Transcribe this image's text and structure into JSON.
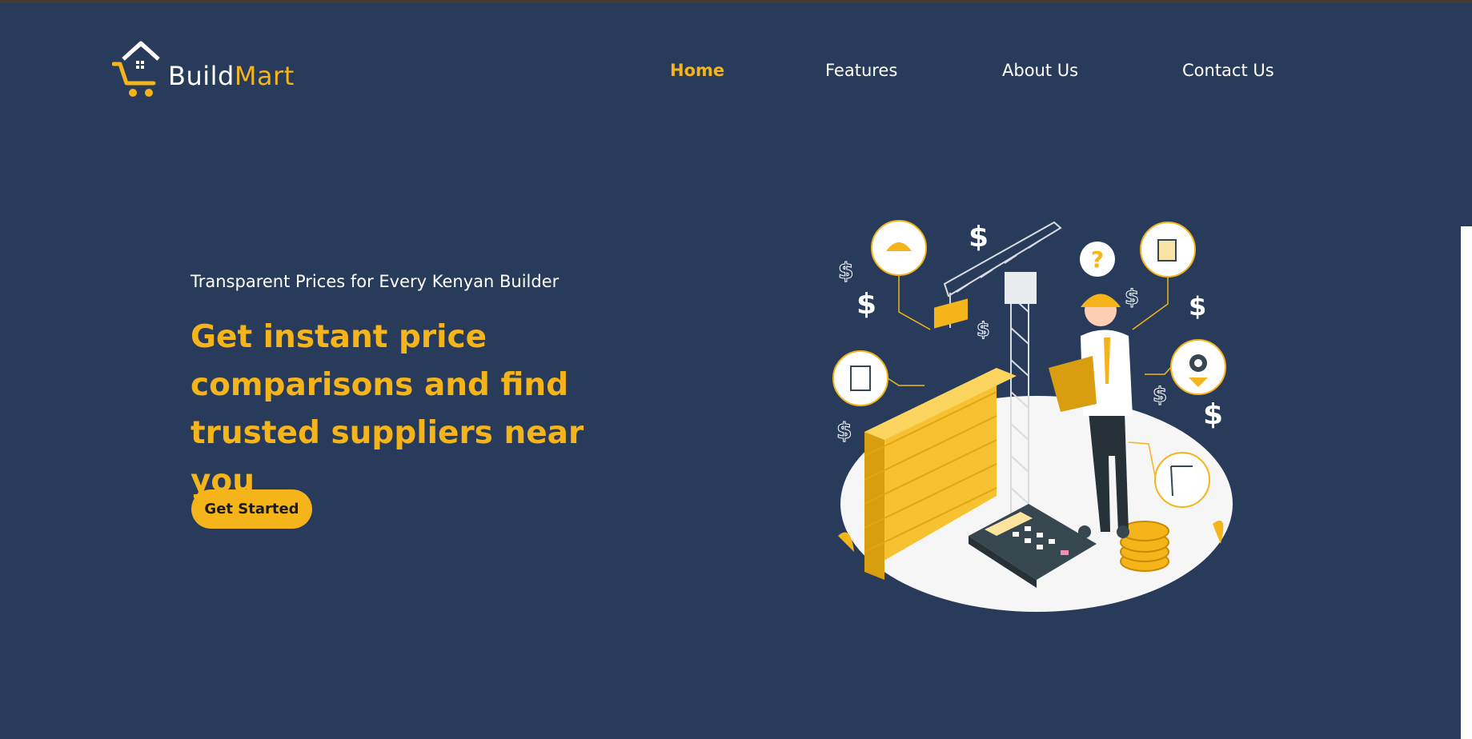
{
  "brand": {
    "name_part1": "Build",
    "name_part2": "Mart"
  },
  "nav": {
    "items": [
      {
        "label": "Home"
      },
      {
        "label": "Features"
      },
      {
        "label": "About Us"
      },
      {
        "label": "Contact Us"
      }
    ]
  },
  "hero": {
    "subtitle": "Transparent Prices for Every Kenyan Builder",
    "headline": "Get instant price comparisons and find trusted suppliers near you",
    "cta_label": "Get Started"
  },
  "colors": {
    "background": "#283b5b",
    "accent": "#f4b41a",
    "text": "#ffffff"
  },
  "icons": [
    "house-cart-logo-icon",
    "dollar-icon",
    "question-mark-icon",
    "gear-icon",
    "helmet-icon",
    "clipboard-icon",
    "crane-icon",
    "calculator-icon",
    "coin-stack-icon"
  ]
}
